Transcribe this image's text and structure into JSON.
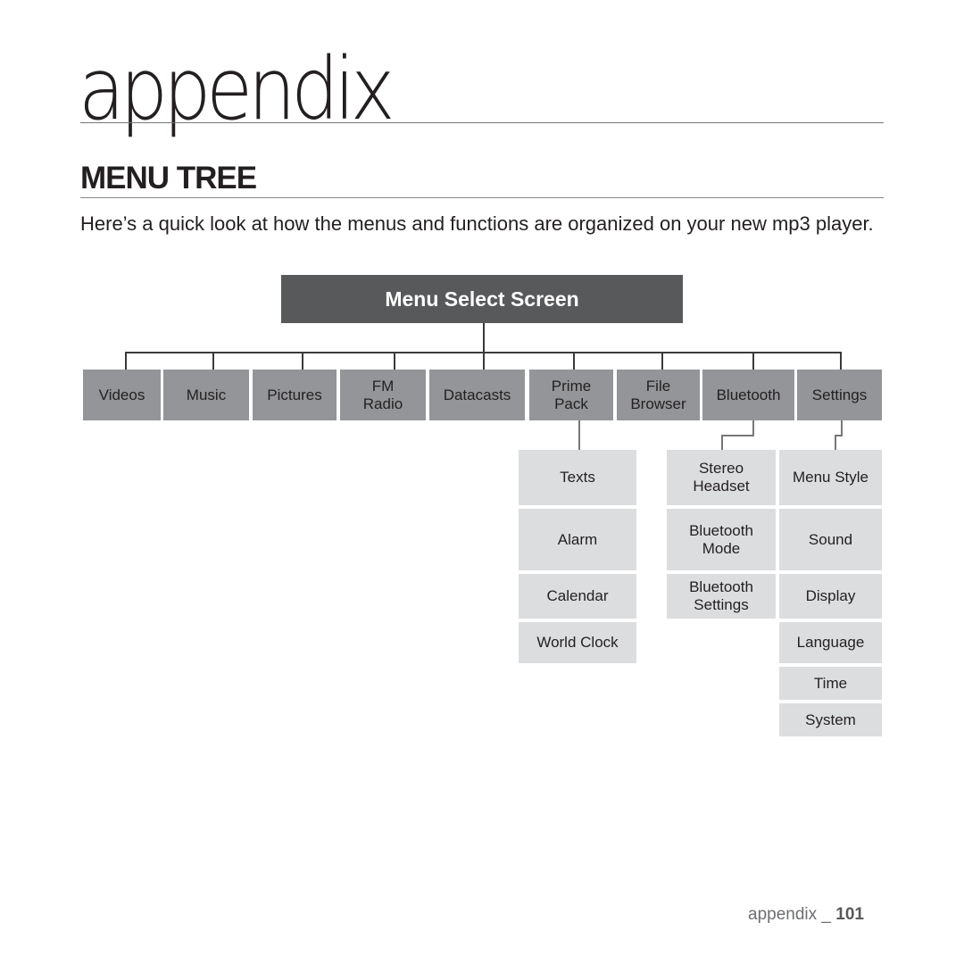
{
  "chapter_title": "appendix",
  "section_title": "MENU TREE",
  "intro": "Here’s a quick look at how the menus and functions are organized on your new mp3 player.",
  "tree": {
    "root": "Menu Select Screen",
    "top_level": [
      "Videos",
      "Music",
      "Pictures",
      "FM\nRadio",
      "Datacasts",
      "Prime\nPack",
      "File\nBrowser",
      "Bluetooth",
      "Settings"
    ],
    "prime_pack": [
      "Texts",
      "Alarm",
      "Calendar",
      "World Clock"
    ],
    "bluetooth": [
      "Stereo\nHeadset",
      "Bluetooth\nMode",
      "Bluetooth\nSettings"
    ],
    "settings": [
      "Menu Style",
      "Sound",
      "Display",
      "Language",
      "Time",
      "System"
    ]
  },
  "footer": {
    "label": "appendix _ ",
    "page": "101"
  }
}
